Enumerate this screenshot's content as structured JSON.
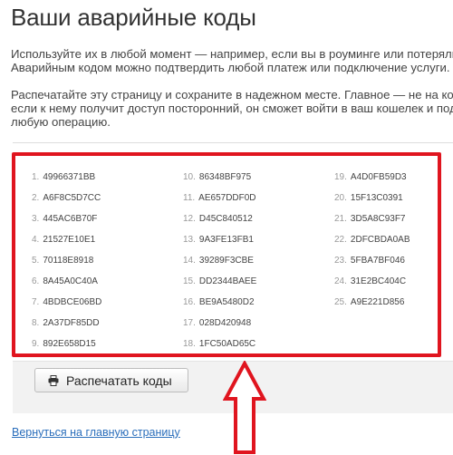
{
  "page": {
    "title": "Ваши аварийные коды",
    "intro_line1": "Используйте их в любой момент — например, если вы в роуминге или потеряли те",
    "intro_line2": "Аварийным кодом можно подтвердить любой платеж или подключение услуги.",
    "warn_line1": "Распечатайте эту страницу и сохраните в надежном месте. Главное — не на комп",
    "warn_line2": "если к нему получит доступ посторонний, он сможет войти в ваш кошелек и подтв",
    "warn_line3": "любую операцию."
  },
  "codes": {
    "col1": [
      {
        "num": "1.",
        "code": "49966371BB"
      },
      {
        "num": "2.",
        "code": "A6F8C5D7CC"
      },
      {
        "num": "3.",
        "code": "445AC6B70F"
      },
      {
        "num": "4.",
        "code": "21527E10E1"
      },
      {
        "num": "5.",
        "code": "70118E8918"
      },
      {
        "num": "6.",
        "code": "8A45A0C40A"
      },
      {
        "num": "7.",
        "code": "4BDBCE06BD"
      },
      {
        "num": "8.",
        "code": "2A37DF85DD"
      },
      {
        "num": "9.",
        "code": "892E658D15"
      }
    ],
    "col2": [
      {
        "num": "10.",
        "code": "86348BF975"
      },
      {
        "num": "11.",
        "code": "AE657DDF0D"
      },
      {
        "num": "12.",
        "code": "D45C840512"
      },
      {
        "num": "13.",
        "code": "9A3FE13FB1"
      },
      {
        "num": "14.",
        "code": "39289F3CBE"
      },
      {
        "num": "15.",
        "code": "DD2344BAEE"
      },
      {
        "num": "16.",
        "code": "BE9A5480D2"
      },
      {
        "num": "17.",
        "code": "028D420948"
      },
      {
        "num": "18.",
        "code": "1FC50AD65C"
      }
    ],
    "col3": [
      {
        "num": "19.",
        "code": "A4D0FB59D3"
      },
      {
        "num": "20.",
        "code": "15F13C0391"
      },
      {
        "num": "21.",
        "code": "3D5A8C93F7"
      },
      {
        "num": "22.",
        "code": "2DFCBDA0AB"
      },
      {
        "num": "23.",
        "code": "5FBA7BF046"
      },
      {
        "num": "24.",
        "code": "31E2BC404C"
      },
      {
        "num": "25.",
        "code": "A9E221D856"
      }
    ]
  },
  "print_button": {
    "label": "Распечатать коды",
    "icon": "printer-icon"
  },
  "back_link": {
    "label": "Вернуться на главную страницу"
  },
  "colors": {
    "highlight": "#e0151f",
    "link": "#2a6ebb"
  }
}
